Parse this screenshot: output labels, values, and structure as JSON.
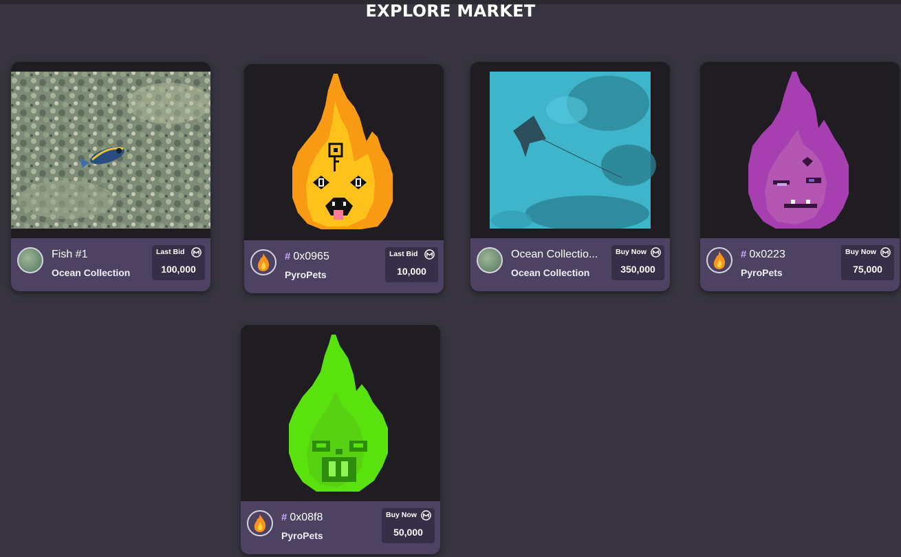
{
  "header": {
    "title": "EXPLORE MARKET"
  },
  "colors": {
    "background": "#37343f",
    "card_footer": "#4d4261",
    "price_box": "#372f47",
    "accent": "#c9a8ff"
  },
  "cards": [
    {
      "name": "Fish #1",
      "hash": "",
      "collection": "Ocean Collection",
      "price_label": "Last Bid",
      "price": "100,000",
      "avatar": "ocean-avatar",
      "image": "fish-photo"
    },
    {
      "name": "0x0965",
      "hash": "#",
      "collection": "PyroPets",
      "price_label": "Last Bid",
      "price": "10,000",
      "avatar": "flame-avatar",
      "image": "orange-pyropet"
    },
    {
      "name": "Ocean Collectio...",
      "hash": "",
      "collection": "Ocean Collection",
      "price_label": "Buy Now",
      "price": "350,000",
      "avatar": "ocean-avatar",
      "image": "stingray-photo"
    },
    {
      "name": "0x0223",
      "hash": "#",
      "collection": "PyroPets",
      "price_label": "Buy Now",
      "price": "75,000",
      "avatar": "flame-avatar",
      "image": "purple-pyropet"
    },
    {
      "name": "0x08f8",
      "hash": "#",
      "collection": "PyroPets",
      "price_label": "Buy Now",
      "price": "50,000",
      "avatar": "flame-avatar",
      "image": "green-pyropet"
    }
  ]
}
